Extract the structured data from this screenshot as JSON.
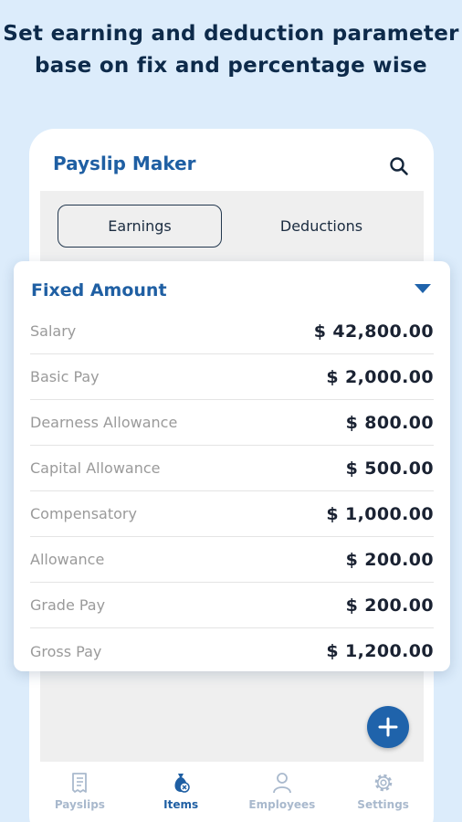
{
  "headline": "Set earning and deduction parameter base on fix and percentage wise",
  "app": {
    "title": "Payslip Maker",
    "search_icon": "search-icon"
  },
  "tabs": [
    {
      "label": "Earnings",
      "selected": true
    },
    {
      "label": "Deductions",
      "selected": false
    }
  ],
  "card": {
    "title": "Fixed Amount",
    "rows": [
      {
        "label": "Salary",
        "value": "$ 42,800.00"
      },
      {
        "label": "Basic Pay",
        "value": "$ 2,000.00"
      },
      {
        "label": "Dearness Allowance",
        "value": "$ 800.00"
      },
      {
        "label": "Capital Allowance",
        "value": "$ 500.00"
      },
      {
        "label": "Compensatory",
        "value": "$ 1,000.00"
      },
      {
        "label": "Allowance",
        "value": "$ 200.00"
      },
      {
        "label": "Grade Pay",
        "value": "$ 200.00"
      },
      {
        "label": "Gross Pay",
        "value": "$ 1,200.00"
      }
    ]
  },
  "fab": {
    "icon": "plus-icon"
  },
  "bottom_nav": [
    {
      "label": "Payslips",
      "icon": "payslip-icon",
      "active": false
    },
    {
      "label": "Items",
      "icon": "money-bag-icon",
      "active": true
    },
    {
      "label": "Employees",
      "icon": "person-icon",
      "active": false
    },
    {
      "label": "Settings",
      "icon": "gear-icon",
      "active": false
    }
  ],
  "colors": {
    "background": "#dcecfb",
    "accent": "#1f5fa3",
    "fab": "#1f63ab",
    "inactive_nav": "#a9b9cd"
  }
}
